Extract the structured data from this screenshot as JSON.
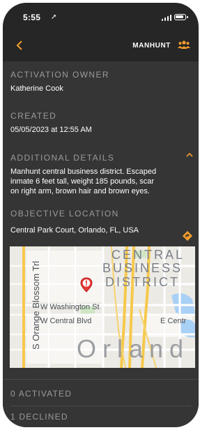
{
  "status_bar": {
    "time": "5:55",
    "location_arrow": "➤"
  },
  "header": {
    "back_icon": "chevron-left-icon",
    "title": "MANHUNT",
    "group_icon": "group-icon"
  },
  "activation_owner": {
    "label": "ACTIVATION OWNER",
    "value": "Katherine Cook"
  },
  "created": {
    "label": "CREATED",
    "value": "05/05/2023 at 12:55 AM"
  },
  "additional_details": {
    "label": "ADDITIONAL DETAILS",
    "value_line1": "Manhunt central business district. Escaped",
    "value_line2": "inmate 6 feet tall, weight 185 pounds, scar",
    "value_line3": "on right arm, brown hair and brown eyes."
  },
  "objective_location": {
    "label": "OBJECTIVE LOCATION",
    "value": "Central Park Court, Orlando, FL, USA"
  },
  "map": {
    "district_line1": "CENTRAL",
    "district_line2": "BUSINESS",
    "district_line3": "DISTRICT",
    "street_vertical": "S Orange Blossom Trl",
    "street1": "W Washington St",
    "street2": "W Central Blvd",
    "street3": "E Centr",
    "city": "Orland"
  },
  "counts": {
    "activated": "0 ACTIVATED",
    "declined": "1 DECLINED"
  },
  "colors": {
    "accent": "#f39c2c",
    "header_bg": "#262626",
    "content_bg": "#353535",
    "marker": "#e53935"
  }
}
